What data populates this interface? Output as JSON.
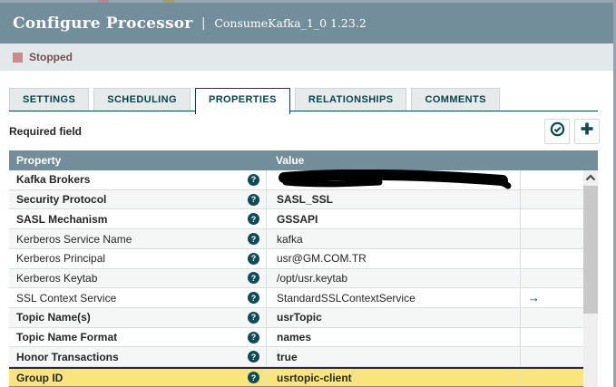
{
  "window": {
    "title": "Configure Processor",
    "separator": "|",
    "subtitle": "ConsumeKafka_1_0 1.23.2"
  },
  "status": {
    "label": "Stopped"
  },
  "tabs": [
    {
      "label": "SETTINGS",
      "active": false
    },
    {
      "label": "SCHEDULING",
      "active": false
    },
    {
      "label": "PROPERTIES",
      "active": true
    },
    {
      "label": "RELATIONSHIPS",
      "active": false
    },
    {
      "label": "COMMENTS",
      "active": false
    }
  ],
  "toolbar": {
    "required_label": "Required field",
    "verify_icon": "check-circle-icon",
    "add_icon": "plus-icon"
  },
  "icons": {
    "help_glyph": "?",
    "goto_glyph": "→",
    "scroll_up": "chevron-up-icon",
    "stopped_square": "stopped-square-icon",
    "redaction": "black-scribble"
  },
  "table": {
    "columns": [
      "Property",
      "Value"
    ],
    "rows": [
      {
        "property": "Kafka Brokers",
        "value": "",
        "redacted": true,
        "required": true,
        "goto": false,
        "highlighted": false
      },
      {
        "property": "Security Protocol",
        "value": "SASL_SSL",
        "required": true,
        "goto": false,
        "highlighted": false
      },
      {
        "property": "SASL Mechanism",
        "value": "GSSAPI",
        "required": true,
        "goto": false,
        "highlighted": false
      },
      {
        "property": "Kerberos Service Name",
        "value": "kafka",
        "required": false,
        "goto": false,
        "highlighted": false
      },
      {
        "property": "Kerberos Principal",
        "value": "usr@GM.COM.TR",
        "required": false,
        "goto": false,
        "highlighted": false
      },
      {
        "property": "Kerberos Keytab",
        "value": "/opt/usr.keytab",
        "required": false,
        "goto": false,
        "highlighted": false
      },
      {
        "property": "SSL Context Service",
        "value": "StandardSSLContextService",
        "required": false,
        "goto": true,
        "highlighted": false
      },
      {
        "property": "Topic Name(s)",
        "value": "usrTopic",
        "required": true,
        "goto": false,
        "highlighted": false
      },
      {
        "property": "Topic Name Format",
        "value": "names",
        "required": true,
        "goto": false,
        "highlighted": false
      },
      {
        "property": "Honor Transactions",
        "value": "true",
        "required": true,
        "goto": false,
        "highlighted": false
      },
      {
        "property": "Group ID",
        "value": "usrtopic-client",
        "required": true,
        "goto": false,
        "highlighted": true
      }
    ]
  },
  "colors": {
    "header_slate": "#728e9b",
    "accent_teal": "#004849",
    "status_bar_bg": "#e3e8ea",
    "stopped_red": "#c98b8b",
    "stopped_text": "#764f4f",
    "highlight_yellow": "#f8e67d",
    "row_alt": "#f5f7f7",
    "row_border": "#d8dee1",
    "help_icon_bg": "#0a4d59"
  }
}
